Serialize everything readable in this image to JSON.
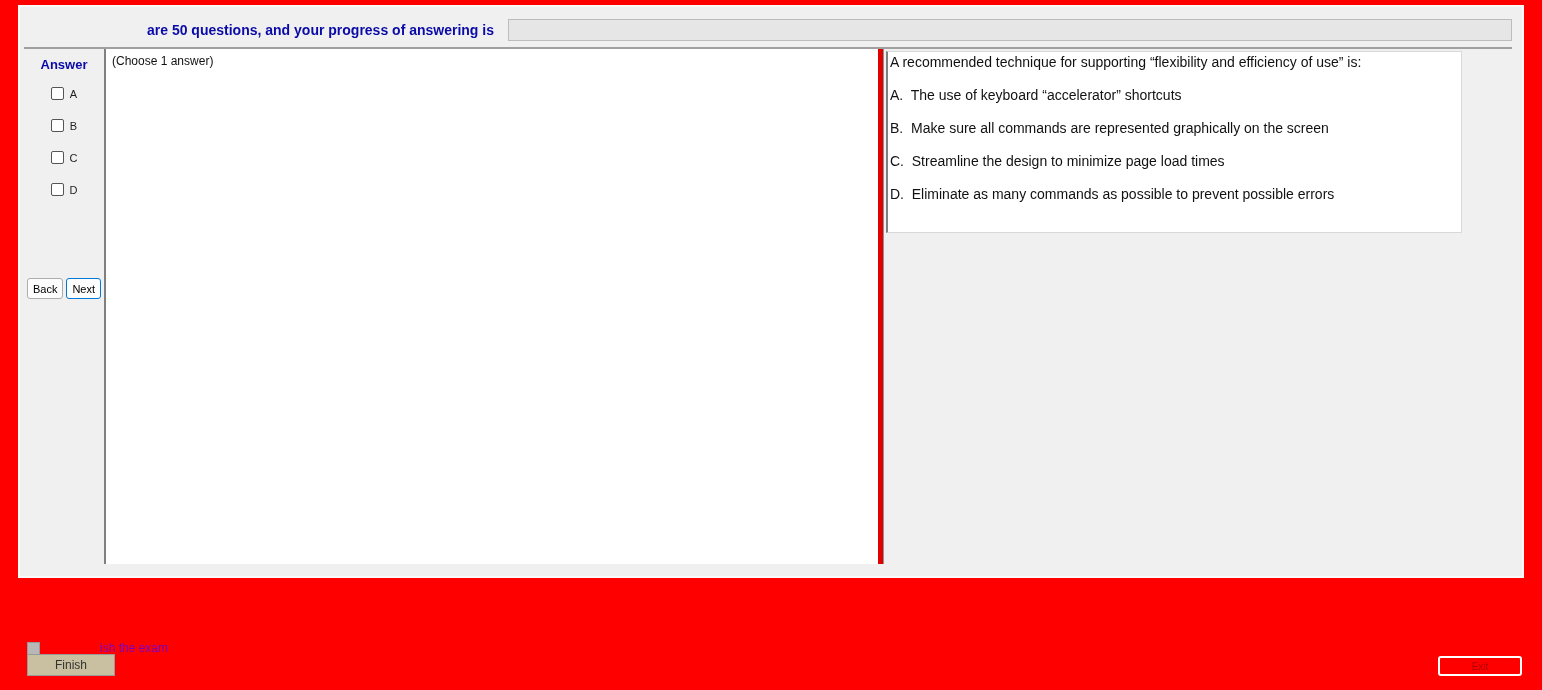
{
  "header": {
    "text": "are 50 questions, and your progress of answering is",
    "progress": {
      "level": 0
    }
  },
  "answer_panel": {
    "title": "Answer",
    "options": [
      {
        "label": "A",
        "checked": false
      },
      {
        "label": "B",
        "checked": false
      },
      {
        "label": "C",
        "checked": false
      },
      {
        "label": "D",
        "checked": false
      }
    ],
    "buttons": [
      {
        "label": "Back",
        "selected": false
      },
      {
        "label": "Next",
        "selected": true
      }
    ]
  },
  "answer_area": {
    "hint": "(Choose 1 answer)"
  },
  "question": {
    "stem": "A recommended technique for supporting “flexibility and efficiency of use” is:",
    "choices": [
      "A.  The use of keyboard “accelerator” shortcuts",
      "B.  Make sure all commands are represented graphically on the screen",
      "C.  Streamline the design to minimize page load times",
      "D.  Eliminate as many commands as possible to prevent possible errors"
    ]
  },
  "footer": {
    "finish_check": {
      "label": "ish the exam",
      "checked": false
    },
    "finish_button": "Finish",
    "exit_button": "Exit"
  }
}
